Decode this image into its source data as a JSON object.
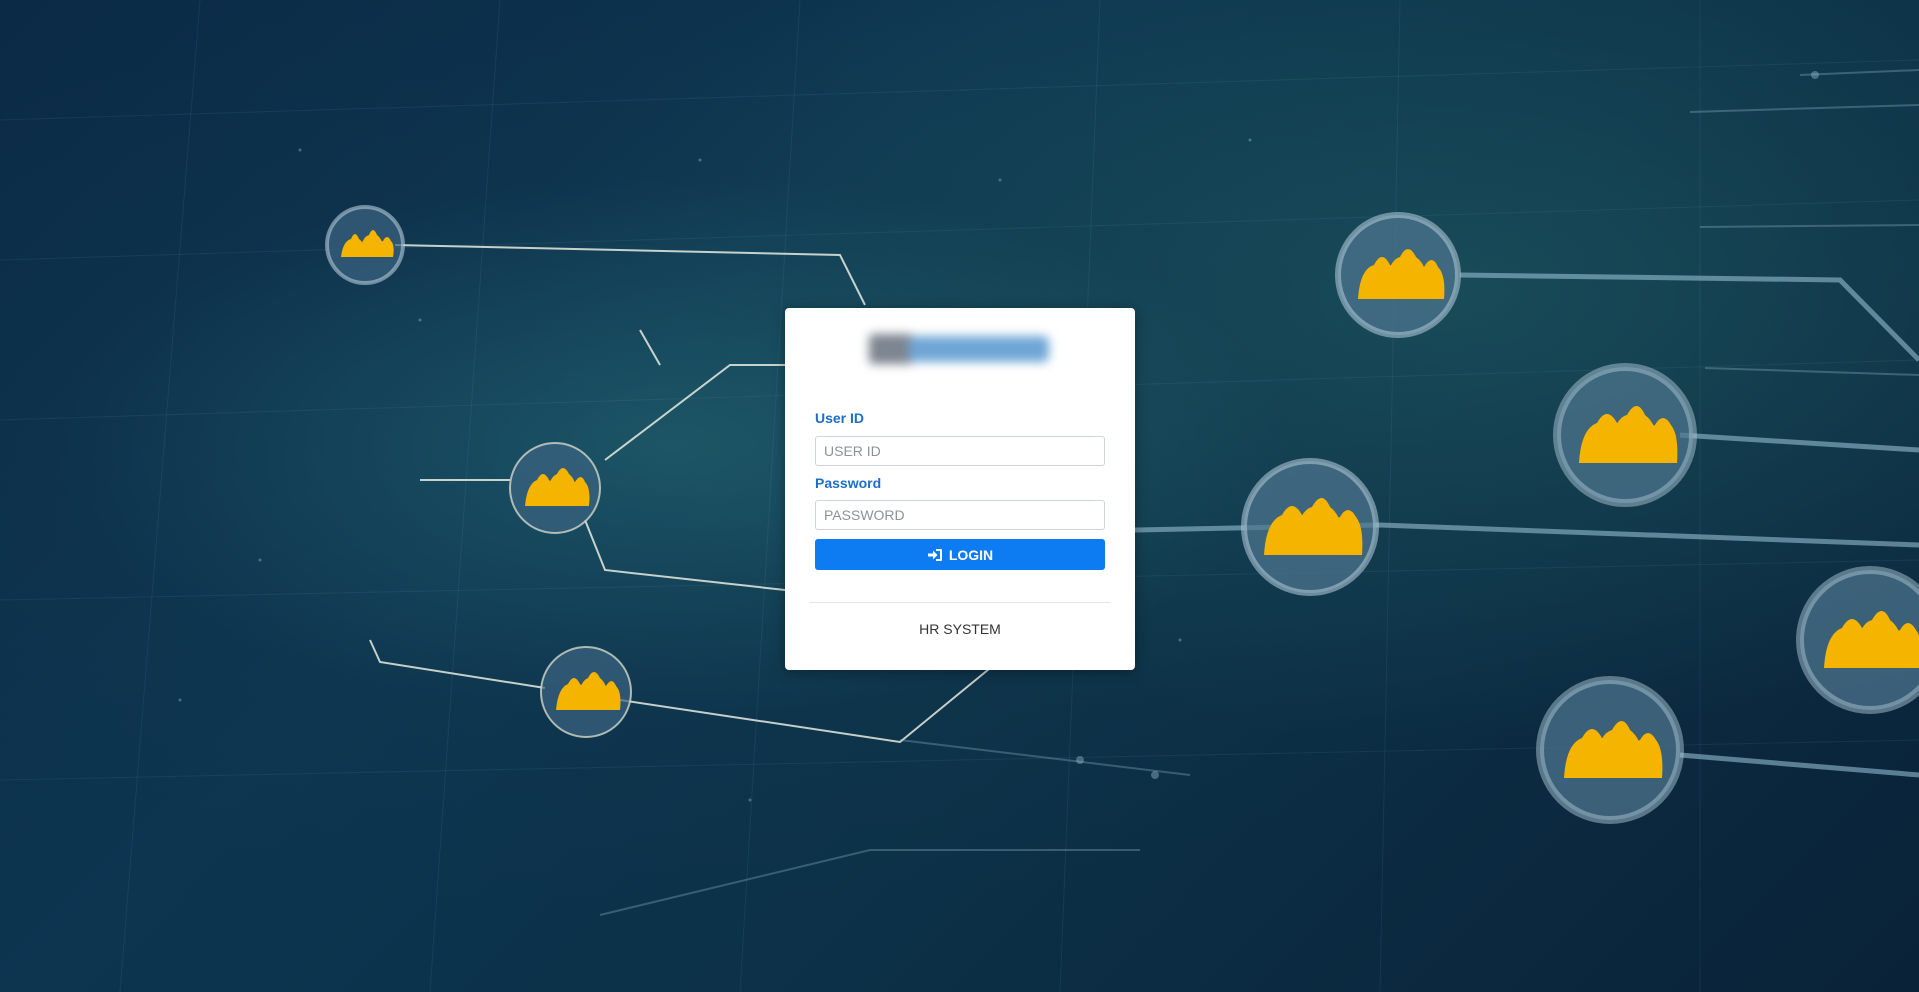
{
  "login": {
    "user_id_label": "User ID",
    "user_id_placeholder": "USER ID",
    "user_id_value": "",
    "password_label": "Password",
    "password_placeholder": "PASSWORD",
    "password_value": "",
    "login_button_label": "LOGIN",
    "login_icon": "sign-in-icon",
    "footer_text": "HR SYSTEM"
  },
  "colors": {
    "accent": "#0d7cf2",
    "label": "#1b6fc9",
    "background": "#0c3148"
  }
}
